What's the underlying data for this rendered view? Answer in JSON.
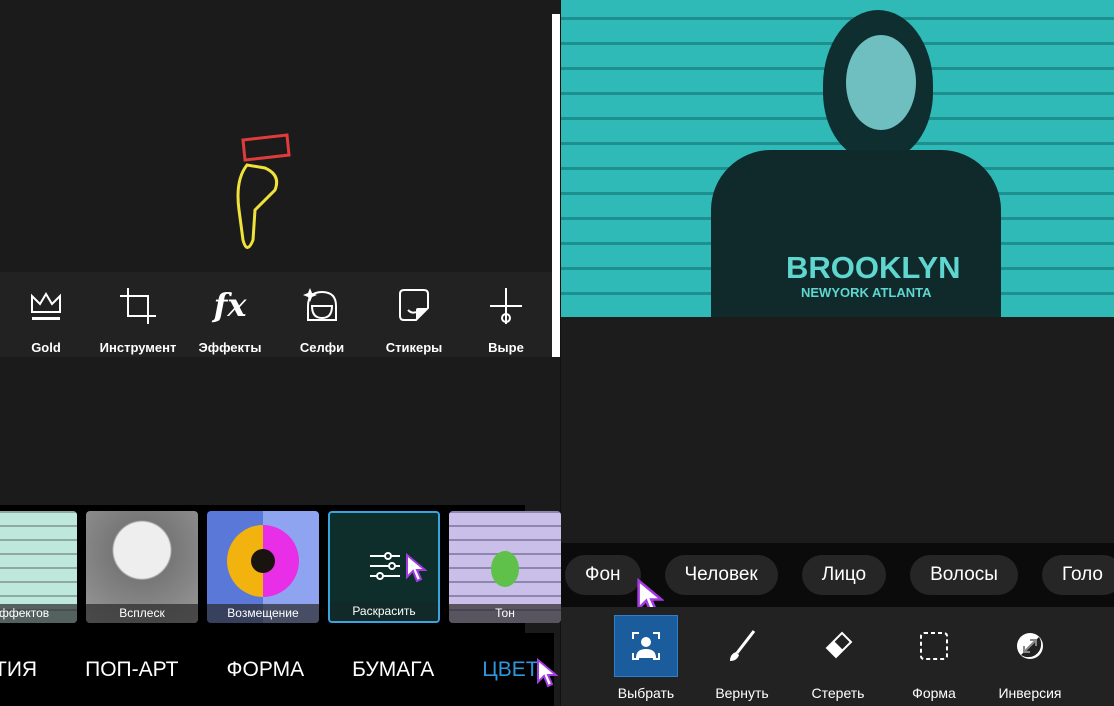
{
  "toolbar": {
    "items": [
      {
        "label": "Gold",
        "icon": "crown-icon"
      },
      {
        "label": "Инструмент",
        "icon": "crop-icon"
      },
      {
        "label": "Эффекты",
        "icon": "fx-icon"
      },
      {
        "label": "Селфи",
        "icon": "selfie-icon"
      },
      {
        "label": "Стикеры",
        "icon": "sticker-icon"
      },
      {
        "label": "Выре",
        "icon": "cutout-icon"
      }
    ]
  },
  "fx_glyph": "fx",
  "effects": {
    "items": [
      {
        "label": "эффектов"
      },
      {
        "label": "Всплеск"
      },
      {
        "label": "Возмещение"
      },
      {
        "label": "Раскрасить",
        "selected": true
      },
      {
        "label": "Тон"
      }
    ]
  },
  "categories": {
    "items": [
      "ТИЯ",
      "ПОП-АРТ",
      "ФОРМА",
      "БУМАГА",
      "ЦВЕТ"
    ],
    "active": "ЦВЕТ"
  },
  "photo": {
    "shirt_text": "BROOKLYN",
    "shirt_sub": "NEWYORK ATLANTA"
  },
  "segments": {
    "items": [
      "Фон",
      "Человек",
      "Лицо",
      "Волосы",
      "Голо"
    ]
  },
  "mask_tools": {
    "items": [
      {
        "label": "Выбрать",
        "icon": "select-person-icon",
        "selected": true
      },
      {
        "label": "Вернуть",
        "icon": "brush-icon"
      },
      {
        "label": "Стереть",
        "icon": "eraser-icon"
      },
      {
        "label": "Форма",
        "icon": "shape-icon"
      },
      {
        "label": "Инверсия",
        "icon": "invert-icon"
      }
    ]
  },
  "colors": {
    "accent": "#2f97dd",
    "selected_tool": "#1b5c9c",
    "photo_tint": "#2fbab8"
  }
}
